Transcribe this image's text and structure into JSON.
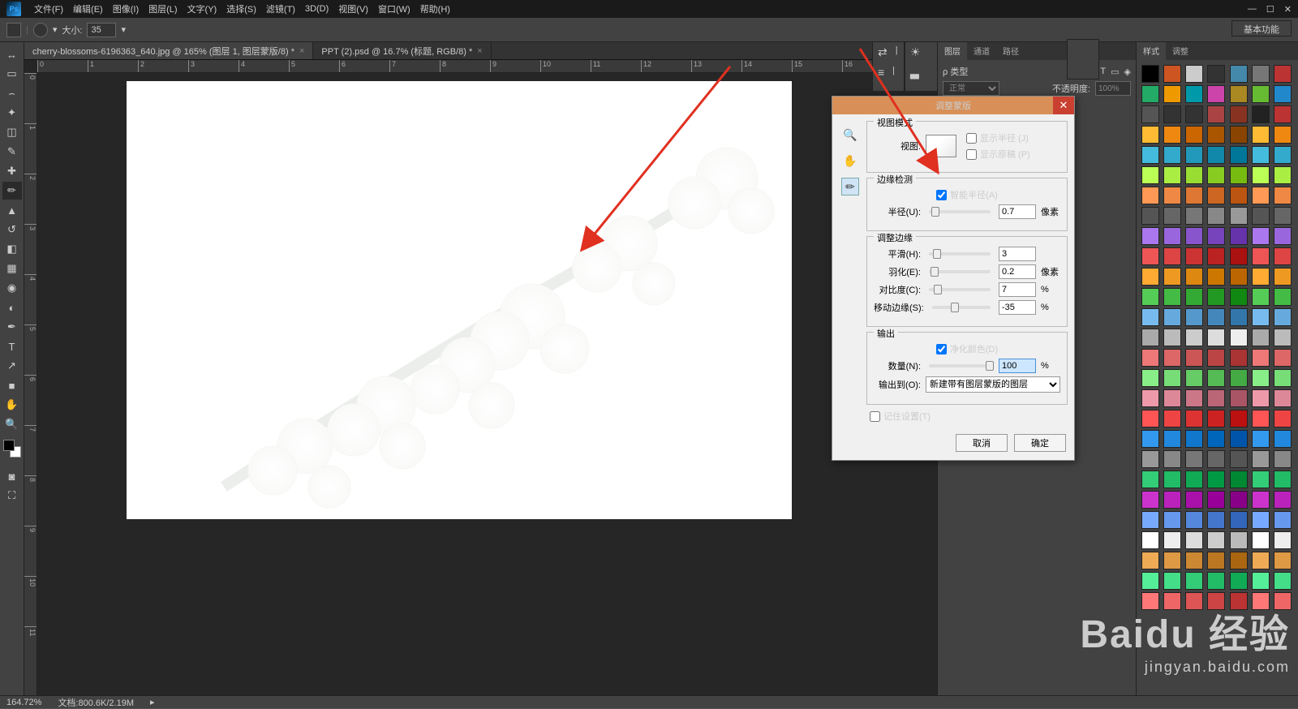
{
  "app": {
    "logo": "Ps"
  },
  "menu": [
    "文件(F)",
    "编辑(E)",
    "图像(I)",
    "图层(L)",
    "文字(Y)",
    "选择(S)",
    "滤镜(T)",
    "3D(D)",
    "视图(V)",
    "窗口(W)",
    "帮助(H)"
  ],
  "top_right_label": "基本功能",
  "options": {
    "size_label": "大小:",
    "size_value": "35"
  },
  "tabs": [
    {
      "label": "cherry-blossoms-6196363_640.jpg @ 165% (图层 1, 图层蒙版/8) *",
      "active": true
    },
    {
      "label": "PPT (2).psd @ 16.7% (标题, RGB/8) *",
      "active": false
    }
  ],
  "ruler_ticks": [
    "0",
    "1",
    "2",
    "3",
    "4",
    "5",
    "6",
    "7",
    "8",
    "9",
    "10",
    "11",
    "12",
    "13",
    "14",
    "15",
    "16"
  ],
  "ruler_v_ticks": [
    "0",
    "1",
    "2",
    "3",
    "4",
    "5",
    "6",
    "7",
    "8",
    "9",
    "10",
    "11"
  ],
  "right_mini": {
    "separator": "|"
  },
  "panel_tabs1": [
    "图层",
    "通道",
    "路径"
  ],
  "panel_tabs2": [
    "样式",
    "调整"
  ],
  "layers": {
    "kind_label": "ρ 类型",
    "mode": "正常",
    "opacity_label": "不透明度:",
    "opacity_value": "100%"
  },
  "styles_colors": [
    "#000",
    "#c52",
    "#ccc",
    "#333",
    "#48a",
    "#777",
    "#b33",
    "#2a6",
    "#e90",
    "#09a",
    "#c4a",
    "#a82",
    "#6b3",
    "#28c",
    "#555",
    "#333",
    "#333",
    "#a44",
    "#832",
    "#222",
    "#b33",
    "#fb3",
    "#e81",
    "#c60",
    "#a50",
    "#840",
    "#fb3",
    "#e81",
    "#4bd",
    "#3ac",
    "#29b",
    "#18a",
    "#079",
    "#4bd",
    "#3ac",
    "#bf5",
    "#ae4",
    "#9d3",
    "#8c2",
    "#7b1",
    "#bf5",
    "#ae4",
    "#f95",
    "#e84",
    "#d73",
    "#c62",
    "#b51",
    "#f95",
    "#e84",
    "#555",
    "#666",
    "#777",
    "#888",
    "#999",
    "#555",
    "#666",
    "#a7e",
    "#96d",
    "#85c",
    "#74b",
    "#63a",
    "#a7e",
    "#96d",
    "#e55",
    "#d44",
    "#c33",
    "#b22",
    "#a11",
    "#e55",
    "#d44",
    "#fa3",
    "#e92",
    "#d81",
    "#c70",
    "#b60",
    "#fa3",
    "#e92",
    "#5c5",
    "#4b4",
    "#3a3",
    "#292",
    "#181",
    "#5c5",
    "#4b4",
    "#7be",
    "#6ad",
    "#59c",
    "#48b",
    "#37a",
    "#7be",
    "#6ad",
    "#aaa",
    "#bbb",
    "#ccc",
    "#ddd",
    "#eee",
    "#aaa",
    "#bbb",
    "#e77",
    "#d66",
    "#c55",
    "#b44",
    "#a33",
    "#e77",
    "#d66",
    "#8e8",
    "#7d7",
    "#6c6",
    "#5b5",
    "#4a4",
    "#8e8",
    "#7d7",
    "#e9a",
    "#d89",
    "#c78",
    "#b67",
    "#a56",
    "#e9a",
    "#d89",
    "#f55",
    "#e44",
    "#d33",
    "#c22",
    "#b11",
    "#f55",
    "#e44",
    "#39e",
    "#28d",
    "#17c",
    "#06b",
    "#05a",
    "#39e",
    "#28d",
    "#999",
    "#888",
    "#777",
    "#666",
    "#555",
    "#999",
    "#888",
    "#3c7",
    "#2b6",
    "#1a5",
    "#094",
    "#083",
    "#3c7",
    "#2b6",
    "#c3c",
    "#b2b",
    "#a1a",
    "#909",
    "#808",
    "#c3c",
    "#b2b",
    "#7af",
    "#69e",
    "#58d",
    "#47c",
    "#36b",
    "#7af",
    "#69e",
    "#fff",
    "#eee",
    "#ddd",
    "#ccc",
    "#bbb",
    "#fff",
    "#eee",
    "#ea5",
    "#d94",
    "#c83",
    "#b72",
    "#a61",
    "#ea5",
    "#d94",
    "#5e9",
    "#4d8",
    "#3c7",
    "#2b6",
    "#1a5",
    "#5e9",
    "#4d8",
    "#f77",
    "#e66",
    "#d55",
    "#c44",
    "#b33",
    "#f77",
    "#e66"
  ],
  "dialog": {
    "title": "调整蒙版",
    "view_mode": {
      "legend": "视图模式",
      "view_label": "视图:",
      "show_radius": "显示半径 (J)",
      "show_original": "显示原稿 (P)"
    },
    "edge_detect": {
      "legend": "边缘检测",
      "smart_radius": "智能半径(A)",
      "radius_label": "半径(U):",
      "radius_value": "0.7",
      "radius_unit": "像素"
    },
    "adjust_edge": {
      "legend": "调整边缘",
      "smooth_label": "平滑(H):",
      "smooth_value": "3",
      "feather_label": "羽化(E):",
      "feather_value": "0.2",
      "feather_unit": "像素",
      "contrast_label": "对比度(C):",
      "contrast_value": "7",
      "contrast_unit": "%",
      "shift_label": "移动边缘(S):",
      "shift_value": "-35",
      "shift_unit": "%"
    },
    "output": {
      "legend": "输出",
      "purify": "净化颜色(D)",
      "amount_label": "数量(N):",
      "amount_value": "100",
      "amount_unit": "%",
      "output_to_label": "输出到(O):",
      "output_to_value": "新建带有图层蒙版的图层"
    },
    "remember": "记住设置(T)",
    "cancel": "取消",
    "ok": "确定"
  },
  "status": {
    "zoom": "164.72%",
    "doc_label": "文档:",
    "doc_info": "800.6K/2.19M"
  },
  "watermark": {
    "brand": "Baidu 经验",
    "url": "jingyan.baidu.com"
  }
}
